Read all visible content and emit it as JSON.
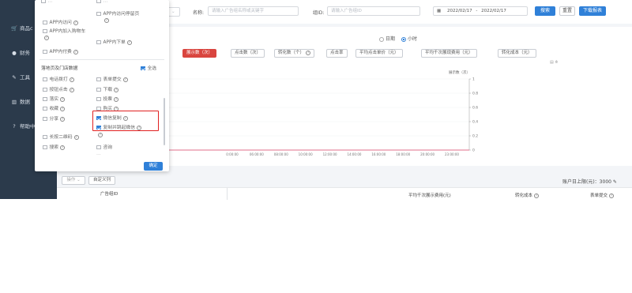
{
  "sidebar": {
    "items": [
      {
        "icon": "cart-icon",
        "glyph": "🛒",
        "label": "商品c"
      },
      {
        "icon": "finance-icon",
        "glyph": "●",
        "label": "财务"
      },
      {
        "icon": "tools-icon",
        "glyph": "✎",
        "label": "工具"
      },
      {
        "icon": "data-icon",
        "glyph": "▥",
        "label": "数据"
      },
      {
        "icon": "help-icon",
        "glyph": "?",
        "label": "帮助中"
      }
    ]
  },
  "filter": {
    "name_label": "名称:",
    "name_placeholder": "请输入广告组名称或关键字",
    "group_id_label": "组ID:",
    "group_id_placeholder": "请输入广告组ID",
    "date_start": "2022/02/17",
    "date_sep": "-",
    "date_end": "2022/02/17",
    "search_button": "搜索",
    "reset_button": "重置",
    "download_button": "下载报表"
  },
  "granularity": {
    "day": "日期",
    "hour": "小时",
    "selected": "hour"
  },
  "metrics": [
    "展示数（次）",
    "点击数（次）",
    "转化数（个）",
    "点击率",
    "平均点击单价（元）",
    "平均千次展现费用（元）",
    "转化成本（元）"
  ],
  "chart_data": {
    "type": "line",
    "y_axis_title": "展示数（次）",
    "y_ticks": [
      "1",
      "0.8",
      "0.6",
      "0.4",
      "0.2",
      "0"
    ],
    "x_ticks": [
      "0:00:00",
      "06:00:00",
      "08:00:00",
      "10:00:00",
      "12:00:00",
      "14:00:00",
      "16:00:00",
      "18:00:00",
      "20:00:00",
      "23:00:00"
    ],
    "series": [
      {
        "values": [
          0,
          0,
          0,
          0,
          0,
          0,
          0,
          0,
          0,
          0
        ]
      }
    ],
    "ylim": [
      0,
      1
    ],
    "series_color": "#e06f8b"
  },
  "popup": {
    "top_items": [
      {
        "label": "APP内访问",
        "checked": false
      },
      {
        "label": "APP内访问停留页",
        "checked": false
      },
      {
        "label": "APP内加入购物车",
        "checked": false
      },
      {
        "label": "APP内下单",
        "checked": false
      },
      {
        "label": "APP内付费",
        "checked": false
      }
    ],
    "section_title": "落地页及门店数据",
    "select_all": "全选",
    "items": [
      {
        "label": "电话拨打",
        "checked": false
      },
      {
        "label": "表单提交",
        "checked": false
      },
      {
        "label": "按钮点击",
        "checked": false
      },
      {
        "label": "下载",
        "checked": false
      },
      {
        "label": "落实",
        "checked": false
      },
      {
        "label": "投票",
        "checked": false
      },
      {
        "label": "收藏",
        "checked": false
      },
      {
        "label": "购买",
        "checked": false
      },
      {
        "label": "分享",
        "checked": false
      },
      {
        "label": "微信复制",
        "checked": true
      },
      {
        "label": "复制并跳起微信",
        "checked": true
      },
      {
        "label": "长按二维码",
        "checked": false
      },
      {
        "label": "搜索",
        "checked": false
      },
      {
        "label": "咨询",
        "checked": false
      }
    ],
    "confirm_button": "确定"
  },
  "table": {
    "ops_button": "操作",
    "custom_columns": "自定义列",
    "budget_text": "账户日上限(元)：3000",
    "headers": [
      "广告组ID",
      "平均千次展示费用(元)",
      "转化成本",
      "表单提交"
    ]
  },
  "colors": {
    "accent": "#2f80d8",
    "active_metric": "#d9453f",
    "highlight_box": "#e02020"
  }
}
